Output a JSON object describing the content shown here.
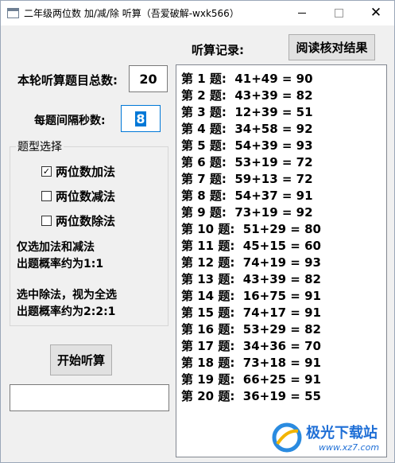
{
  "window": {
    "title": "二年级两位数 加/减/除 听算（吾爱破解-wxk566）",
    "close_glyph": "✕"
  },
  "settings": {
    "total_label": "本轮听算题目总数:",
    "total_value": "20",
    "interval_label": "每题间隔秒数:",
    "interval_value": "8"
  },
  "question_types": {
    "caption": "题型选择",
    "options": [
      {
        "label": "两位数加法",
        "checked": true
      },
      {
        "label": "两位数减法",
        "checked": false
      },
      {
        "label": "两位数除法",
        "checked": false
      }
    ],
    "note1_line1": "仅选加法和减法",
    "note1_line2": "出题概率约为1:1",
    "note2_line1": "选中除法，视为全选",
    "note2_line2": "出题概率约为2:2:1"
  },
  "actions": {
    "start_label": "开始听算",
    "status_value": "",
    "check_results_label": "阅读核对结果"
  },
  "records": {
    "title": "听算记录:",
    "lines": [
      "第 1 题:  41+49 = 90",
      "第 2 题:  43+39 = 82",
      "第 3 题:  12+39 = 51",
      "第 4 题:  34+58 = 92",
      "第 5 题:  54+39 = 93",
      "第 6 题:  53+19 = 72",
      "第 7 题:  59+13 = 72",
      "第 8 题:  54+37 = 91",
      "第 9 题:  73+19 = 92",
      "第 10 题:  51+29 = 80",
      "第 11 题:  45+15 = 60",
      "第 12 题:  74+19 = 93",
      "第 13 题:  43+39 = 82",
      "第 14 题:  16+75 = 91",
      "第 15 题:  74+17 = 91",
      "第 16 题:  53+29 = 82",
      "第 17 题:  34+36 = 70",
      "第 18 题:  73+18 = 91",
      "第 19 题:  66+25 = 91",
      "第 20 题:  36+19 = 55"
    ]
  },
  "watermark": {
    "name": "极光下载站",
    "url": "www.xz7.com"
  }
}
